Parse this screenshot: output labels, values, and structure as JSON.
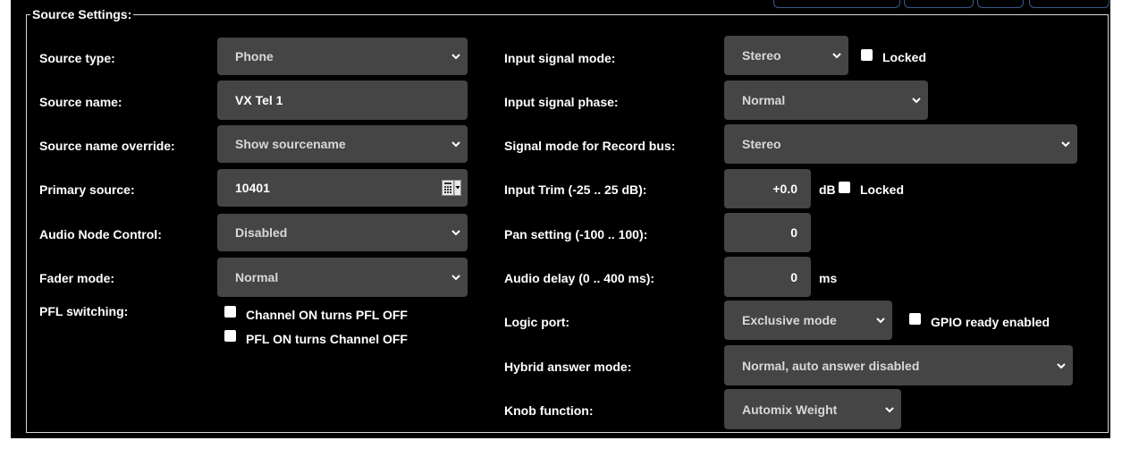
{
  "panel_title": "Source Settings:",
  "left": {
    "source_type": {
      "label": "Source type:",
      "value": "Phone"
    },
    "source_name": {
      "label": "Source name:",
      "value": "VX Tel 1"
    },
    "source_name_override": {
      "label": "Source name override:",
      "value": "Show sourcename"
    },
    "primary_source": {
      "label": "Primary source:",
      "value": "10401"
    },
    "audio_node_control": {
      "label": "Audio Node Control:",
      "value": "Disabled"
    },
    "fader_mode": {
      "label": "Fader mode:",
      "value": "Normal"
    },
    "pfl_switching": {
      "label": "PFL switching:",
      "options": [
        {
          "label": "Channel ON turns PFL OFF",
          "checked": false
        },
        {
          "label": "PFL ON turns Channel OFF",
          "checked": false
        }
      ]
    }
  },
  "right": {
    "input_signal_mode": {
      "label": "Input signal mode:",
      "value": "Stereo",
      "locked_label": "Locked",
      "locked": false
    },
    "input_signal_phase": {
      "label": "Input signal phase:",
      "value": "Normal"
    },
    "record_bus_mode": {
      "label": "Signal mode for Record bus:",
      "value": "Stereo"
    },
    "input_trim": {
      "label": "Input Trim (-25 .. 25 dB):",
      "value": "+0.0",
      "unit": "dB",
      "locked_label": "Locked",
      "locked": false
    },
    "pan_setting": {
      "label": "Pan setting (-100 .. 100):",
      "value": "0"
    },
    "audio_delay": {
      "label": "Audio delay (0 .. 400 ms):",
      "value": "0",
      "unit": "ms"
    },
    "logic_port": {
      "label": "Logic port:",
      "value": "Exclusive mode",
      "gpio_label": "GPIO ready enabled",
      "gpio": false
    },
    "hybrid_answer_mode": {
      "label": "Hybrid answer mode:",
      "value": "Normal, auto answer disabled"
    },
    "knob_function": {
      "label": "Knob function:",
      "value": "Automix Weight"
    }
  }
}
